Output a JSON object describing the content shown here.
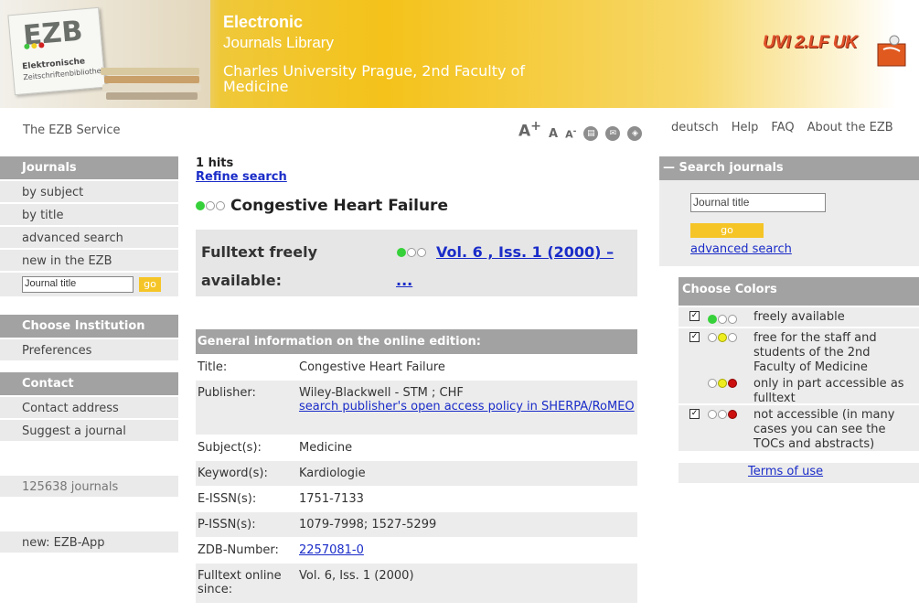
{
  "header": {
    "logo_text": "EZB",
    "logo_sub1": "Elektronische",
    "logo_sub2": "Zeitschriftenbibliothek",
    "title_line1": "Electronic",
    "title_line2": "Journals Library",
    "institution": "Charles University Prague, 2nd Faculty of Medicine",
    "partner_logo": "UVI 2.LF UK"
  },
  "topbar": {
    "service": "The EZB Service",
    "font_large": "A",
    "font_large_sup": "+",
    "font_mid": "A",
    "font_small": "A",
    "font_small_sup": "-",
    "links": [
      "deutsch",
      "Help",
      "FAQ",
      "About the EZB"
    ]
  },
  "sidebar": {
    "journals_head": "Journals",
    "journals_items": [
      "by subject",
      "by title",
      "advanced search",
      "new in the EZB"
    ],
    "search_value": "Journal title",
    "go": "go",
    "institution_head": "Choose Institution",
    "preferences": "Preferences",
    "contact_head": "Contact",
    "contact_items": [
      "Contact address",
      "Suggest a journal"
    ],
    "count": "125638 journals",
    "app": "new: EZB-App"
  },
  "main": {
    "hits": "1 hits",
    "refine": "Refine search",
    "journal_title": "Congestive Heart Failure",
    "fulltext_label": "Fulltext freely available:",
    "fulltext_vol": "Vol. 6 , Iss. 1 (2000) – ...",
    "general_head": "General information on the online edition:",
    "info": [
      {
        "k": "Title:",
        "v": "Congestive Heart Failure"
      },
      {
        "k": "Publisher:",
        "v": "Wiley-Blackwell - STM ; CHF",
        "link": "search publisher's open access policy in SHERPA/RoMEO"
      },
      {
        "k": "Subject(s):",
        "v": "Medicine"
      },
      {
        "k": "Keyword(s):",
        "v": "Kardiologie"
      },
      {
        "k": "E-ISSN(s):",
        "v": "1751-7133"
      },
      {
        "k": "P-ISSN(s):",
        "v": "1079-7998; 1527-5299"
      },
      {
        "k": "ZDB-Number:",
        "v": "2257081-0"
      },
      {
        "k": "Fulltext online since:",
        "v": "Vol. 6, Iss. 1 (2000)"
      }
    ]
  },
  "right": {
    "search_head": "Search journals",
    "search_collapse": "—",
    "search_value": "Journal title",
    "go": "go",
    "advanced": "advanced search",
    "colors_head": "Choose Colors",
    "colors": [
      {
        "checked": true,
        "text": "freely available"
      },
      {
        "checked": true,
        "text": "free for the staff and students of the 2nd Faculty of Medicine"
      },
      {
        "checked": false,
        "text": "only in part accessible as fulltext"
      },
      {
        "checked": true,
        "text": "not accessible (in many cases you can see the TOCs and abstracts)"
      }
    ],
    "terms": "Terms of use"
  },
  "colors": {
    "header_yellow": "#f4c21a",
    "sidebar_head": "#a2a2a2",
    "link": "#1a2cc8",
    "go_button": "#f5c528"
  }
}
